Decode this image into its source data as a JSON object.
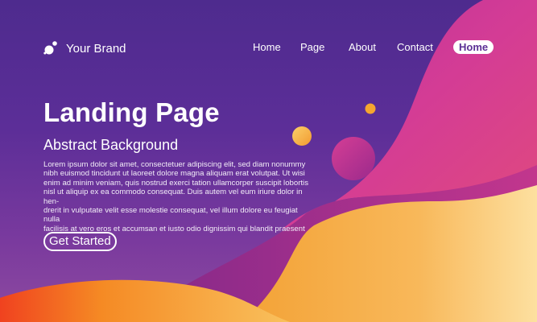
{
  "brand": {
    "name": "Your Brand",
    "icon": "brand-dots-icon"
  },
  "nav": {
    "items": [
      "Home",
      "Page",
      "About",
      "Contact"
    ],
    "active": "Home"
  },
  "hero": {
    "title": "Landing Page",
    "subtitle": "Abstract Background",
    "body_lines": [
      "Lorem ipsum dolor sit amet, consectetuer adipiscing elit, sed diam nonummy",
      "nibh euismod tincidunt ut laoreet dolore magna aliquam erat volutpat. Ut wisi",
      "enim ad minim veniam, quis nostrud exerci tation ullamcorper suscipit lobortis",
      "nisl ut aliquip ex ea commodo consequat. Duis autem vel eum iriure dolor in hen-",
      "drerit in vulputate velit esse molestie consequat, vel illum dolore eu feugiat nulla",
      "facilisis at vero eros et accumsan et iusto odio dignissim qui blandit praesent"
    ],
    "cta_label": "Get Started"
  },
  "colors": {
    "background_purple": "#5c2e98",
    "magenta": "#d43c95",
    "orange": "#f59a2a",
    "cream": "#fcd98c",
    "red_orange": "#f04b24"
  }
}
